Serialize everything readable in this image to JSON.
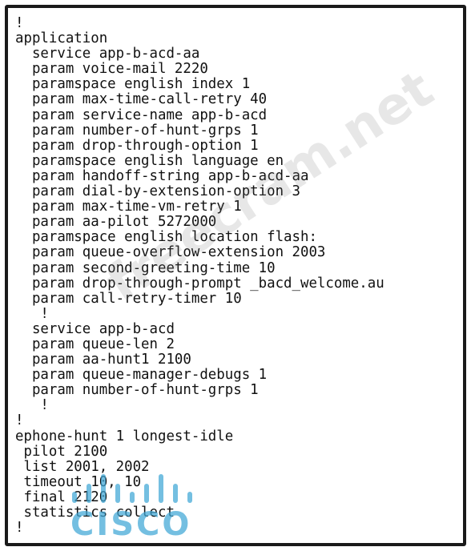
{
  "config_lines": [
    "!",
    "application",
    "  service app-b-acd-aa",
    "  param voice-mail 2220",
    "  paramspace english index 1",
    "  param max-time-call-retry 40",
    "  param service-name app-b-acd",
    "  param number-of-hunt-grps 1",
    "  param drop-through-option 1",
    "  paramspace english language en",
    "  param handoff-string app-b-acd-aa",
    "  param dial-by-extension-option 3",
    "  param max-time-vm-retry 1",
    "  param aa-pilot 5272000",
    "  paramspace english location flash:",
    "  param queue-overflow-extension 2003",
    "  param second-greeting-time 10",
    "  param drop-through-prompt _bacd_welcome.au",
    "  param call-retry-timer 10",
    "   !",
    "  service app-b-acd",
    "  param queue-len 2",
    "  param aa-hunt1 2100",
    "  param queue-manager-debugs 1",
    "  param number-of-hunt-grps 1",
    "   !",
    "!",
    "ephone-hunt 1 longest-idle",
    " pilot 2100",
    " list 2001, 2002",
    " timeout 10, 10",
    " final 2120",
    " statistics collect",
    "!"
  ],
  "watermark": "freecram.net",
  "logo": {
    "text": "CISCO",
    "icon": "cisco-bridge-logo-icon",
    "color": "#3fa7d6"
  }
}
